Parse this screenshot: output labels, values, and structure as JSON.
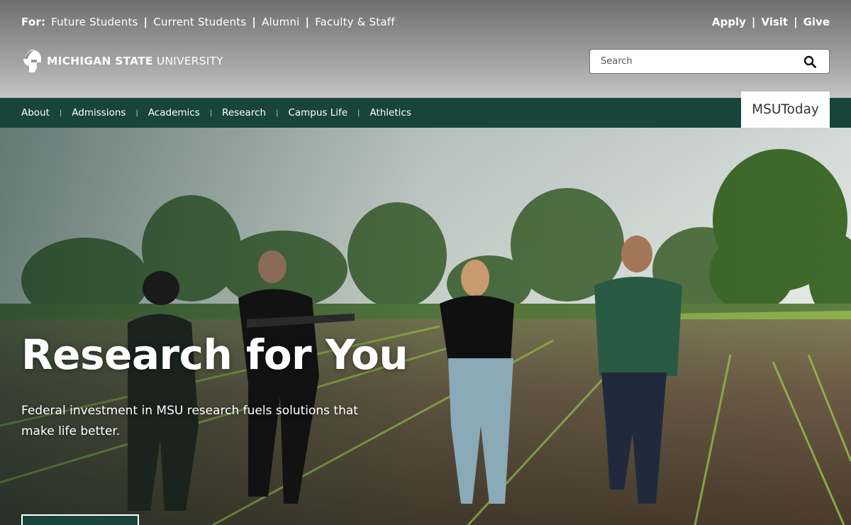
{
  "utility": {
    "for_label": "For:",
    "audience_links": [
      "Future Students",
      "Current Students",
      "Alumni",
      "Faculty & Staff"
    ],
    "action_links": [
      "Apply",
      "Visit",
      "Give"
    ],
    "separator": "|"
  },
  "logo": {
    "text_bold": "MICHIGAN STATE",
    "text_regular": "UNIVERSITY",
    "icon": "spartan-helmet-icon"
  },
  "search": {
    "placeholder": "Search",
    "icon": "search-icon"
  },
  "mainnav": {
    "items": [
      "About",
      "Admissions",
      "Academics",
      "Research",
      "Campus Life",
      "Athletics"
    ],
    "separator": "|",
    "featured": "MSUToday"
  },
  "hero": {
    "title": "Research for You",
    "subtitle": "Federal investment in MSU research fuels solutions that make life better."
  },
  "colors": {
    "brand_green": "#18453b",
    "header_gray": "#9c9c9c"
  }
}
